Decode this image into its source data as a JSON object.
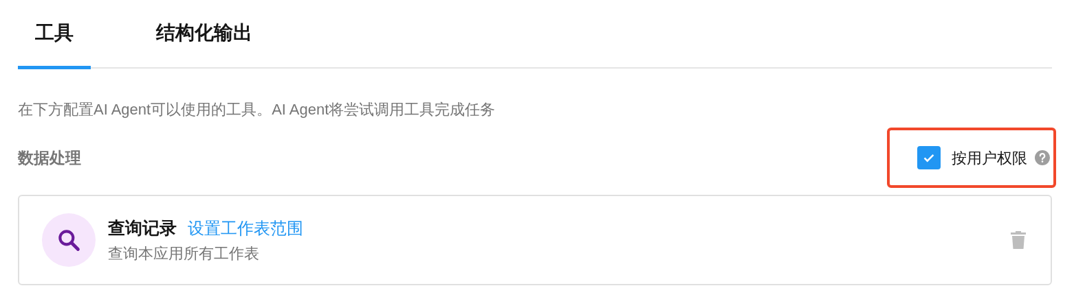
{
  "tabs": [
    {
      "label": "工具",
      "selected": true
    },
    {
      "label": "结构化输出",
      "selected": false
    }
  ],
  "description": "在下方配置AI Agent可以使用的工具。AI Agent将尝试调用工具完成任务",
  "section": {
    "title": "数据处理",
    "permission": {
      "label": "按用户权限",
      "checked": true,
      "highlighted": true
    },
    "tools": [
      {
        "title": "查询记录",
        "link": "设置工作表范围",
        "subtitle": "查询本应用所有工作表"
      }
    ]
  }
}
